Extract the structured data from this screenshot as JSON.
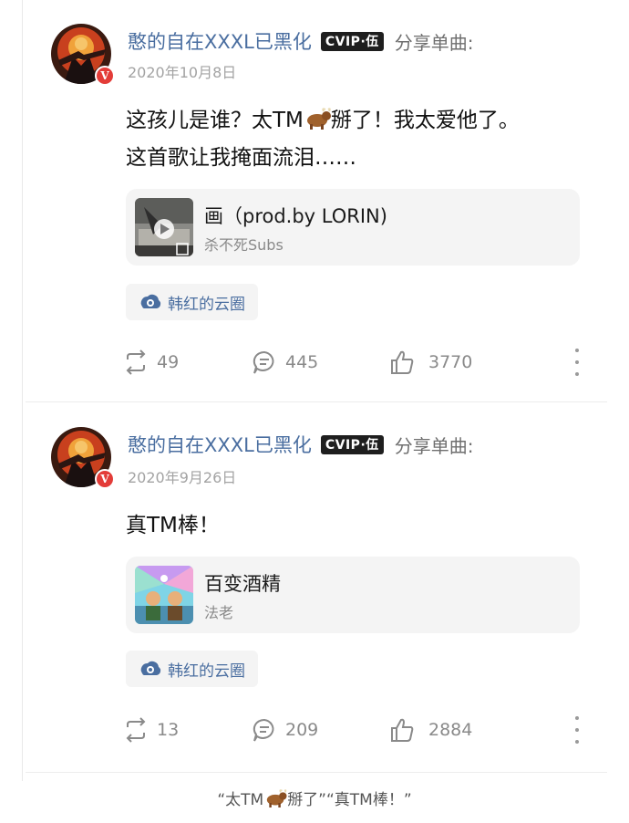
{
  "posts": [
    {
      "username": "憨的自在XXXL已黑化",
      "vip_badge": "CVIP·伍",
      "share_label": "分享单曲:",
      "avatar_badge": "V",
      "date": "2020年10月8日",
      "text_line1_before": "这孩儿是谁？太TM",
      "text_line1_after": "掰了！我太爱他了。",
      "text_line2": "这首歌让我掩面流泪……",
      "song_title": "画（prod.by LORIN)",
      "song_artist": "杀不死Subs",
      "circle_label": "韩红的云圈",
      "repost_count": "49",
      "comment_count": "445",
      "like_count": "3770"
    },
    {
      "username": "憨的自在XXXL已黑化",
      "vip_badge": "CVIP·伍",
      "share_label": "分享单曲:",
      "avatar_badge": "V",
      "date": "2020年9月26日",
      "text_line1_before": "真TM棒！",
      "song_title": "百变酒精",
      "song_artist": "法老",
      "circle_label": "韩红的云圈",
      "repost_count": "13",
      "comment_count": "209",
      "like_count": "2884"
    }
  ],
  "caption": {
    "before": "“太TM",
    "after": "掰了”“真TM棒！”"
  },
  "colors": {
    "username": "#4a6ea0",
    "count": "#8a8a8a",
    "card_bg": "#f4f4f4",
    "vip_bg": "#1e1e1e",
    "v_badge": "#e33c38"
  },
  "icons": [
    "repost-icon",
    "comment-icon",
    "like-icon",
    "more-icon",
    "cloud-circle-icon",
    "ox-emoji-icon",
    "play-icon"
  ]
}
